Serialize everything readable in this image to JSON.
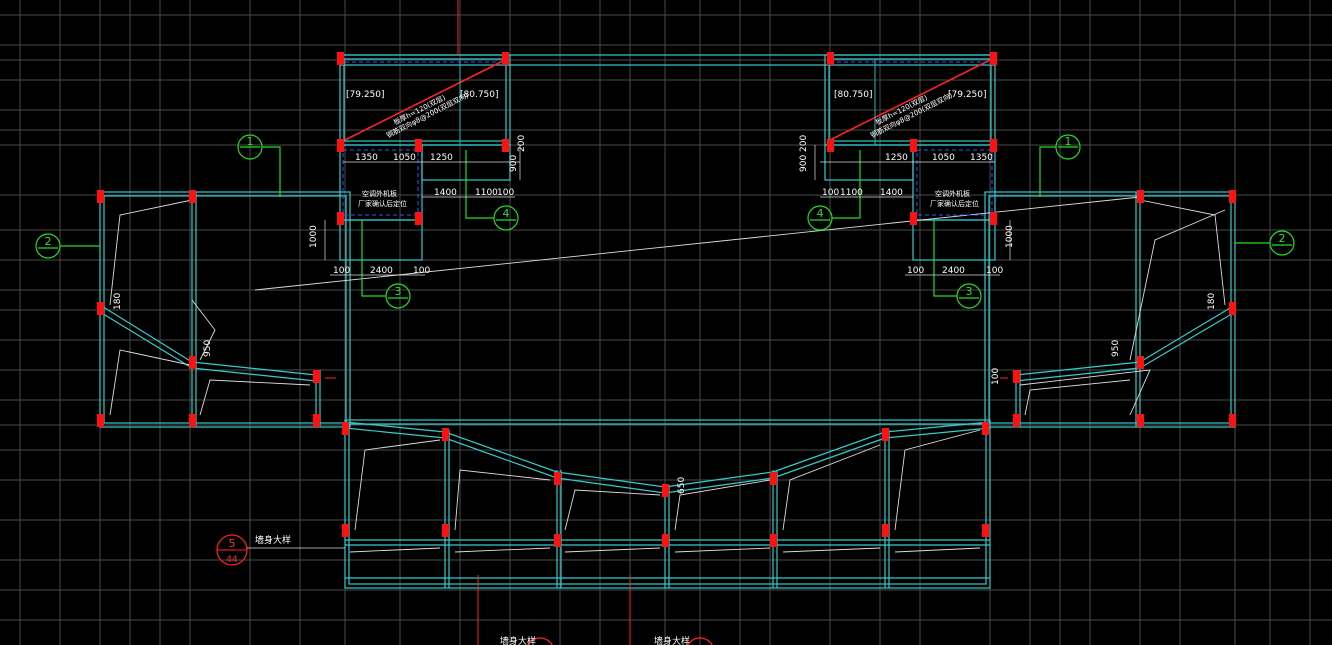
{
  "levels": {
    "l1": "[79.250]",
    "l2": "[80.750]",
    "r1": "[80.750]",
    "r2": "[79.250]"
  },
  "notes": {
    "roof_note_1": "板厚h=120(双层)",
    "roof_note_2": "钢筋双向φ8@200(双层双向)",
    "room_note_1": "空调外机板",
    "room_note_2": "厂家确认后定位",
    "detail_text": "墙身大样",
    "bottom_text_1": "墙身大样",
    "bottom_text_2": "墙身大样"
  },
  "dims": {
    "d1350": "1350",
    "d1050": "1050",
    "d1250": "1250",
    "d900": "900",
    "d200": "200",
    "d1400": "1400",
    "d1100": "1100",
    "d100": "100",
    "d1000": "1000",
    "d2400": "2400",
    "d180": "180",
    "d950": "950",
    "d650": "650"
  },
  "grid_bubbles": {
    "b1": "1",
    "b2": "2",
    "b3": "3",
    "b4": "4"
  },
  "detail_marker": {
    "number": "5",
    "sheet": "44"
  },
  "colors": {
    "background": "#000000",
    "grid": "#4a4a4a",
    "wall": "#33cccc",
    "column": "#ff1111",
    "axis_bubble": "#22dd22",
    "annotation": "#ffffff",
    "hidden_line": "#3355ff"
  }
}
